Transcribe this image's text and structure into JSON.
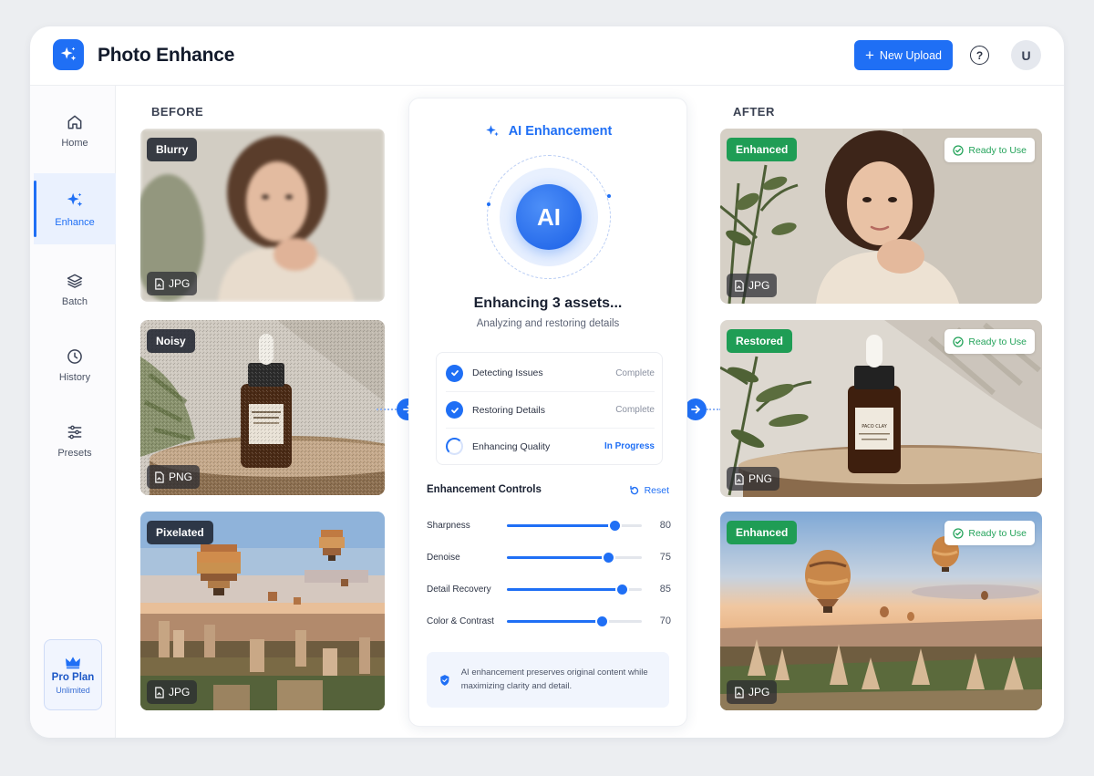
{
  "app": {
    "title": "Photo Enhance"
  },
  "header": {
    "new_upload_label": "New Upload",
    "help_label": "?",
    "avatar_initial": "U"
  },
  "sidebar": {
    "items": [
      {
        "label": "Home",
        "icon": "home-icon"
      },
      {
        "label": "Enhance",
        "icon": "sparkle-icon",
        "active": true
      },
      {
        "label": "Batch",
        "icon": "layers-icon"
      },
      {
        "label": "History",
        "icon": "clock-icon"
      },
      {
        "label": "Presets",
        "icon": "sliders-icon"
      }
    ],
    "plan": {
      "title": "Pro Plan",
      "subtitle": "Unlimited",
      "icon": "crown-icon"
    }
  },
  "before": {
    "label": "BEFORE",
    "images": [
      {
        "tag": "Blurry",
        "format": "JPG"
      },
      {
        "tag": "Noisy",
        "format": "PNG"
      },
      {
        "tag": "Pixelated",
        "format": "JPG"
      }
    ]
  },
  "after": {
    "label": "AFTER",
    "images": [
      {
        "tag": "Enhanced",
        "format": "JPG",
        "status": "Ready to Use"
      },
      {
        "tag": "Restored",
        "format": "PNG",
        "status": "Ready to Use"
      },
      {
        "tag": "Enhanced",
        "format": "JPG",
        "status": "Ready to Use"
      }
    ]
  },
  "panel": {
    "title": "AI Enhancement",
    "orb_label": "AI",
    "status_title": "Enhancing 3 assets...",
    "status_subtitle": "Analyzing and restoring details",
    "steps": [
      {
        "label": "Detecting Issues",
        "status": "Complete"
      },
      {
        "label": "Restoring Details",
        "status": "Complete"
      },
      {
        "label": "Enhancing Quality",
        "status": "In Progress"
      }
    ],
    "controls_title": "Enhancement Controls",
    "reset_label": "Reset",
    "sliders": [
      {
        "label": "Sharpness",
        "value": 80
      },
      {
        "label": "Denoise",
        "value": 75
      },
      {
        "label": "Detail Recovery",
        "value": 85
      },
      {
        "label": "Color & Contrast",
        "value": 70
      }
    ],
    "note": "AI enhancement preserves original content while maximizing clarity and detail."
  },
  "colors": {
    "accent": "#1f6ff5",
    "success": "#1f9d55",
    "tag_dark": "#1c212d"
  }
}
